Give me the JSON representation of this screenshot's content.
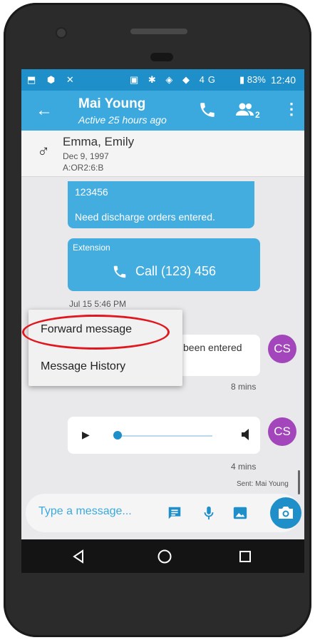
{
  "status_bar": {
    "left_icons": "⬒ ⬢ ✕",
    "mid_icons": "▣ ✱ ◈ ◆ 4G",
    "battery": "▮ 83%",
    "time": "12:40"
  },
  "app_bar": {
    "title": "Mai Young",
    "subtitle": "Active 25 hours ago",
    "group_count": "2"
  },
  "patient": {
    "gender_symbol": "♂",
    "name": "Emma, Emily",
    "dob": "Dec 9, 1997",
    "location": "A:OR2:6:B"
  },
  "messages": {
    "top_bubble_line1": "123456",
    "top_bubble_line2": "Need discharge orders entered.",
    "extension_label": "Extension",
    "call_text": "Call (123) 456",
    "time1": "Jul 15 5:46 PM",
    "right_bubble_text": "been entered",
    "avatar_initials": "CS",
    "time2": "8 mins",
    "time3": "4 mins",
    "sent_by": "Sent: Mai Young"
  },
  "context_menu": {
    "items": [
      {
        "label": "Forward message"
      },
      {
        "label": "Message History"
      }
    ]
  },
  "composer": {
    "placeholder": "Type a message..."
  },
  "colors": {
    "status_bar": "#1f8fc9",
    "app_bar": "#3ba9de",
    "bubble": "#44ade0",
    "avatar": "#a346bb",
    "highlight": "#e0171e"
  }
}
